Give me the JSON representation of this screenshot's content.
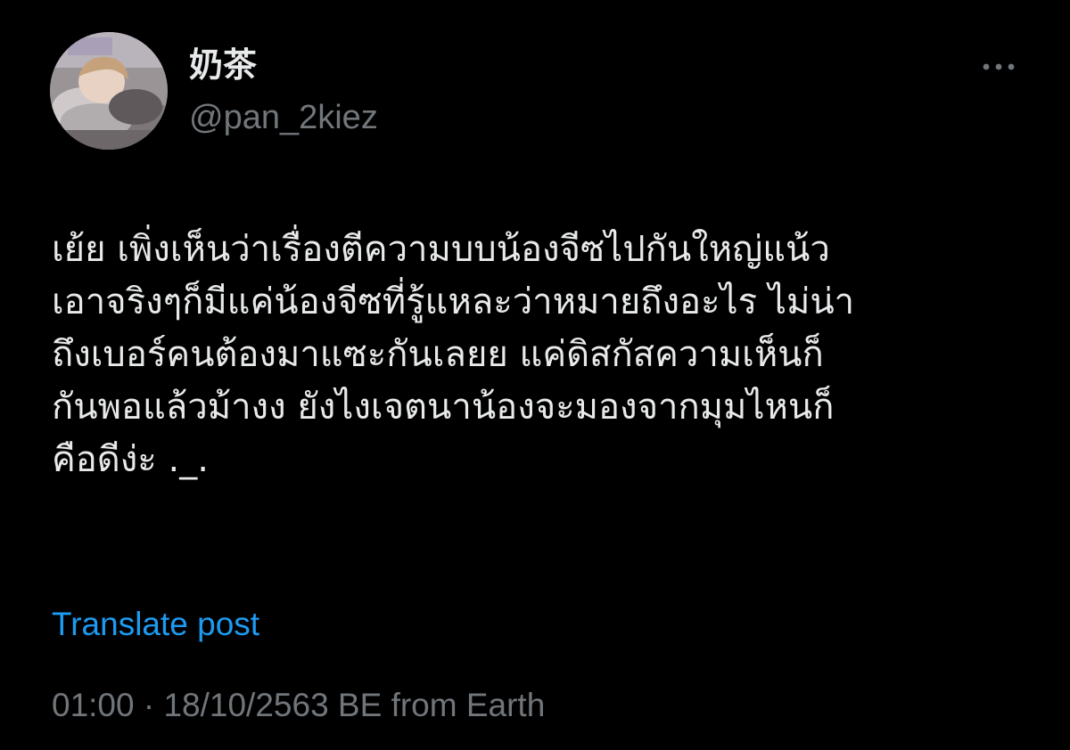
{
  "tweet": {
    "author": {
      "display_name": "奶茶",
      "handle": "@pan_2kiez"
    },
    "text_lines": [
      "เย้ย เพิ่งเห็นว่าเรื่องตีความบบน้องจีซไปกันใหญ่แน้ว",
      "เอาจริงๆก็มีแค่น้องจีซที่รู้แหละว่าหมายถึงอะไร ไม่น่า",
      "ถึงเบอร์คนต้องมาแซะกันเลยย แค่ดิสกัสความเห็นก็",
      "กันพอแล้วม้างง ยังไงเจตนาน้องจะมองจากมุมไหนก็",
      "คือดีง่ะ ._."
    ],
    "translate_label": "Translate post",
    "meta": "01:00 · 18/10/2563 BE from Earth"
  },
  "icons": {
    "more": "more-horizontal-icon",
    "avatar": "profile-photo"
  },
  "colors": {
    "background": "#000000",
    "primary_text": "#e7e9ea",
    "secondary_text": "#71767b",
    "link": "#1d9bf0"
  }
}
